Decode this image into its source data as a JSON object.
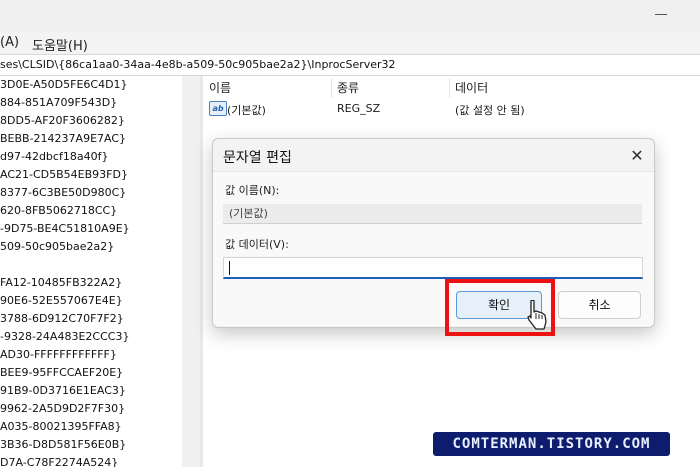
{
  "menubar": {
    "items": [
      "(A)",
      "도움말(H)"
    ]
  },
  "address": {
    "path": "ses\\CLSID\\{86ca1aa0-34aa-4e8b-a509-50c905bae2a2}\\InprocServer32"
  },
  "tree": {
    "items": [
      "3D0E-A50D5FE6C4D1}",
      "884-851A709F543D}",
      "8DD5-AF20F3606282}",
      "BEBB-214237A9E7AC}",
      "d97-42dbcf18a40f}",
      "AC21-CD5B54EB93FD}",
      "8377-6C3BE50D980C}",
      "620-8FB5062718CC}",
      "-9D75-BE4C51810A9E}",
      "509-50c905bae2a2}",
      "",
      "FA12-10485FB322A2}",
      "90E6-52E557067E4E}",
      "3788-6D912C70F7F2}",
      "-9328-24A483E2CCC3}",
      "AD30-FFFFFFFFFFFF}",
      "BEE9-95FFCCAEF20E}",
      "91B9-0D3716E1EAC3}",
      "9962-2A5D9D2F7F30}",
      "A035-80021395FFA8}",
      "3B36-D8D581F56E0B}",
      "D7A-C78F2274A524}"
    ]
  },
  "list": {
    "columns": [
      "이름",
      "종류",
      "데이터"
    ],
    "rows": [
      {
        "name": "(기본값)",
        "type": "REG_SZ",
        "data": "(값 설정 안 됨)",
        "icon": "ab"
      }
    ]
  },
  "dialog": {
    "title": "문자열 편집",
    "value_name_label": "값 이름(N):",
    "value_name": "(기본값)",
    "value_data_label": "값 데이터(V):",
    "value_data": "",
    "ok_label": "확인",
    "cancel_label": "취소"
  },
  "watermark": "COMTERMAN.TISTORY.COM",
  "colors": {
    "highlight": "#ee1111",
    "accent": "#1e5fb7",
    "watermark_bg": "#0e1c6e"
  }
}
